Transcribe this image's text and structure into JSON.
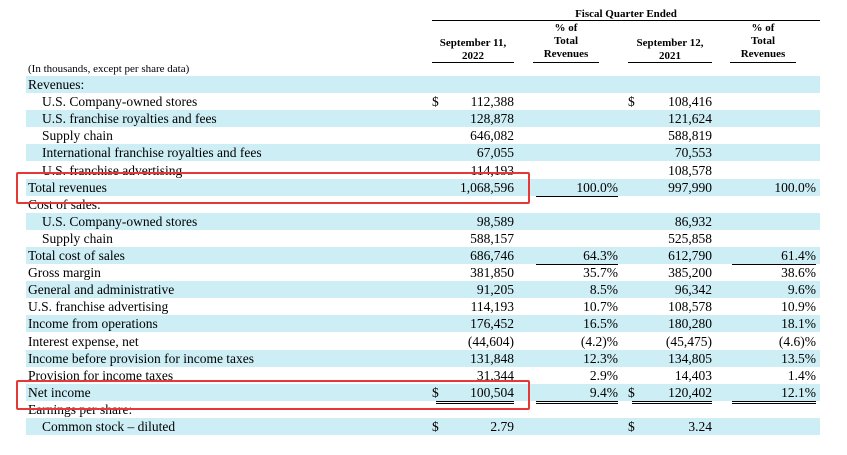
{
  "header": {
    "group_title": "Fiscal Quarter Ended",
    "col1": "September 11,\n2022",
    "col1_pct": "% of\nTotal\nRevenues",
    "col2": "September 12,\n2021",
    "col2_pct": "% of\nTotal\nRevenues",
    "note": "(In thousands, except per share data)"
  },
  "rows": [
    {
      "label": "Revenues:",
      "indent": false,
      "shade": true,
      "d1": "",
      "v1": "",
      "p1": "",
      "d2": "",
      "v2": "",
      "p2": ""
    },
    {
      "label": "U.S. Company-owned stores",
      "indent": true,
      "shade": false,
      "d1": "$",
      "v1": "112,388",
      "p1": "",
      "d2": "$",
      "v2": "108,416",
      "p2": ""
    },
    {
      "label": "U.S. franchise royalties and fees",
      "indent": true,
      "shade": true,
      "d1": "",
      "v1": "128,878",
      "p1": "",
      "d2": "",
      "v2": "121,624",
      "p2": ""
    },
    {
      "label": "Supply chain",
      "indent": true,
      "shade": false,
      "d1": "",
      "v1": "646,082",
      "p1": "",
      "d2": "",
      "v2": "588,819",
      "p2": ""
    },
    {
      "label": "International franchise royalties and fees",
      "indent": true,
      "shade": true,
      "d1": "",
      "v1": "67,055",
      "p1": "",
      "d2": "",
      "v2": "70,553",
      "p2": ""
    },
    {
      "label": "U.S. franchise advertising",
      "indent": true,
      "shade": false,
      "d1": "",
      "v1": "114,193",
      "p1": "",
      "d2": "",
      "v2": "108,578",
      "p2": ""
    },
    {
      "label": "Total revenues",
      "indent": false,
      "shade": true,
      "d1": "",
      "v1": "1,068,596",
      "p1": "100.0%",
      "d2": "",
      "v2": "997,990",
      "p2": "100.0%"
    },
    {
      "label": "Cost of sales:",
      "indent": false,
      "shade": false,
      "d1": "",
      "v1": "",
      "p1": "",
      "d2": "",
      "v2": "",
      "p2": ""
    },
    {
      "label": "U.S. Company-owned stores",
      "indent": true,
      "shade": true,
      "d1": "",
      "v1": "98,589",
      "p1": "",
      "d2": "",
      "v2": "86,932",
      "p2": ""
    },
    {
      "label": "Supply chain",
      "indent": true,
      "shade": false,
      "d1": "",
      "v1": "588,157",
      "p1": "",
      "d2": "",
      "v2": "525,858",
      "p2": ""
    },
    {
      "label": "Total cost of sales",
      "indent": false,
      "shade": true,
      "d1": "",
      "v1": "686,746",
      "p1": "64.3%",
      "d2": "",
      "v2": "612,790",
      "p2": "61.4%"
    },
    {
      "label": "Gross margin",
      "indent": false,
      "shade": false,
      "d1": "",
      "v1": "381,850",
      "p1": "35.7%",
      "d2": "",
      "v2": "385,200",
      "p2": "38.6%"
    },
    {
      "label": "General and administrative",
      "indent": false,
      "shade": true,
      "d1": "",
      "v1": "91,205",
      "p1": "8.5%",
      "d2": "",
      "v2": "96,342",
      "p2": "9.6%"
    },
    {
      "label": "U.S. franchise advertising",
      "indent": false,
      "shade": false,
      "d1": "",
      "v1": "114,193",
      "p1": "10.7%",
      "d2": "",
      "v2": "108,578",
      "p2": "10.9%"
    },
    {
      "label": "Income from operations",
      "indent": false,
      "shade": true,
      "d1": "",
      "v1": "176,452",
      "p1": "16.5%",
      "d2": "",
      "v2": "180,280",
      "p2": "18.1%"
    },
    {
      "label": "Interest expense, net",
      "indent": false,
      "shade": false,
      "d1": "",
      "v1": "(44,604)",
      "p1": "(4.2)%",
      "d2": "",
      "v2": "(45,475)",
      "p2": "(4.6)%"
    },
    {
      "label": "Income before provision for income taxes",
      "indent": false,
      "shade": true,
      "d1": "",
      "v1": "131,848",
      "p1": "12.3%",
      "d2": "",
      "v2": "134,805",
      "p2": "13.5%"
    },
    {
      "label": "Provision for income taxes",
      "indent": false,
      "shade": false,
      "d1": "",
      "v1": "31,344",
      "p1": "2.9%",
      "d2": "",
      "v2": "14,403",
      "p2": "1.4%"
    },
    {
      "label": "Net income",
      "indent": false,
      "shade": true,
      "d1": "$",
      "v1": "100,504",
      "p1": "9.4%",
      "d2": "$",
      "v2": "120,402",
      "p2": "12.1%"
    },
    {
      "label": "Earnings per share:",
      "indent": false,
      "shade": false,
      "d1": "",
      "v1": "",
      "p1": "",
      "d2": "",
      "v2": "",
      "p2": ""
    },
    {
      "label": "Common stock – diluted",
      "indent": true,
      "shade": true,
      "d1": "$",
      "v1": "2.79",
      "p1": "",
      "d2": "$",
      "v2": "3.24",
      "p2": ""
    }
  ],
  "highlight_color": "#e53935",
  "shade_color": "#cdeef5"
}
